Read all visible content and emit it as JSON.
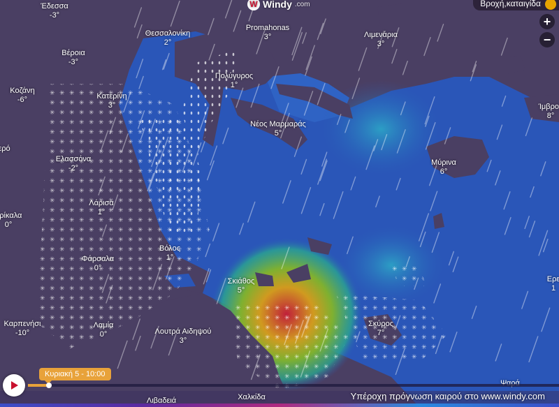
{
  "app": {
    "brand": "Windy",
    "brand_suffix": ".com",
    "layer_label": "Βροχή,καταιγίδα"
  },
  "controls": {
    "zoom_in": "+",
    "zoom_out": "−"
  },
  "timeline": {
    "current_time": "Κυριακή 5 - 10:00",
    "progress": 0.04
  },
  "footer": {
    "text": "Υπέροχη πρόγνωση καιρού στο www.windy.com"
  },
  "cities": [
    {
      "name": "Έδεσσα",
      "temp": "-3°"
    },
    {
      "name": "Θεσσαλονίκη",
      "temp": "2°"
    },
    {
      "name": "Promahonas",
      "temp": "3°"
    },
    {
      "name": "Λιμενάρια",
      "temp": "3°"
    },
    {
      "name": "Βέροια",
      "temp": "-3°"
    },
    {
      "name": "Πολύγυρος",
      "temp": "1°"
    },
    {
      "name": "Κοζάνη",
      "temp": "-6°"
    },
    {
      "name": "Κατερίνη",
      "temp": "3°"
    },
    {
      "name": "Νέος Μαρμαράς",
      "temp": "5°"
    },
    {
      "name": "Ίμβρος",
      "temp": "8°"
    },
    {
      "name": "Μύρινα",
      "temp": "6°"
    },
    {
      "name": "Ελασσόνα",
      "temp": "-2°"
    },
    {
      "name": "Λάρισα",
      "temp": "1°"
    },
    {
      "name": "Τρίκαλα",
      "temp": "0°"
    },
    {
      "name": "Βόλος",
      "temp": "1°"
    },
    {
      "name": "Φάρσαλα",
      "temp": "0°"
    },
    {
      "name": "Σκιάθος",
      "temp": "5°"
    },
    {
      "name": "Ερε",
      "temp": "1"
    },
    {
      "name": "Καρπενήσι",
      "temp": "-10°"
    },
    {
      "name": "Λαμία",
      "temp": "0°"
    },
    {
      "name": "Λουτρά Αιδηψού",
      "temp": "3°"
    },
    {
      "name": "Σκύρος",
      "temp": "7°"
    },
    {
      "name": "Λιβαδειά",
      "temp": ""
    },
    {
      "name": "Χαλκίδα",
      "temp": ""
    },
    {
      "name": "Ψαρά",
      "temp": ""
    },
    {
      "name": "ερό",
      "temp": ""
    }
  ],
  "colors": {
    "land": "#4a3f63",
    "sea": "#2a56b8",
    "accent": "#e8a23a"
  }
}
